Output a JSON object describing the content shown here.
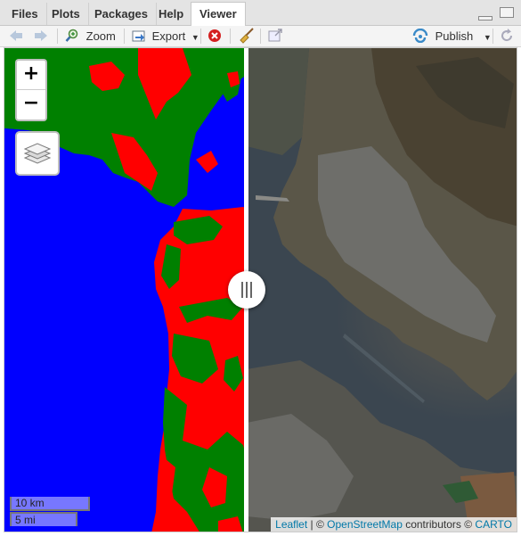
{
  "tabs": [
    {
      "label": "Files"
    },
    {
      "label": "Plots"
    },
    {
      "label": "Packages"
    },
    {
      "label": "Help"
    },
    {
      "label": "Viewer"
    }
  ],
  "active_tab": "Viewer",
  "toolbar": {
    "zoom_label": "Zoom",
    "export_label": "Export",
    "publish_label": "Publish"
  },
  "map": {
    "zoom_in_label": "+",
    "zoom_out_label": "−",
    "scale_km": "10 km",
    "scale_mi": "5 mi",
    "attribution": {
      "leaflet": "Leaflet",
      "sep1": " | © ",
      "osm": "OpenStreetMap",
      "middle": " contributors © ",
      "carto": "CARTO"
    },
    "classified_colors": {
      "water": "#0000ff",
      "vegetation": "#008000",
      "urban": "#ff0000"
    }
  },
  "icons": {
    "back": "back-arrow-icon",
    "forward": "forward-arrow-icon",
    "zoom": "magnifier-icon",
    "export": "export-icon",
    "remove": "remove-plot-icon",
    "clear": "broom-icon",
    "popout": "popout-icon",
    "publish": "publish-icon",
    "refresh": "refresh-icon",
    "layers": "layers-icon"
  }
}
